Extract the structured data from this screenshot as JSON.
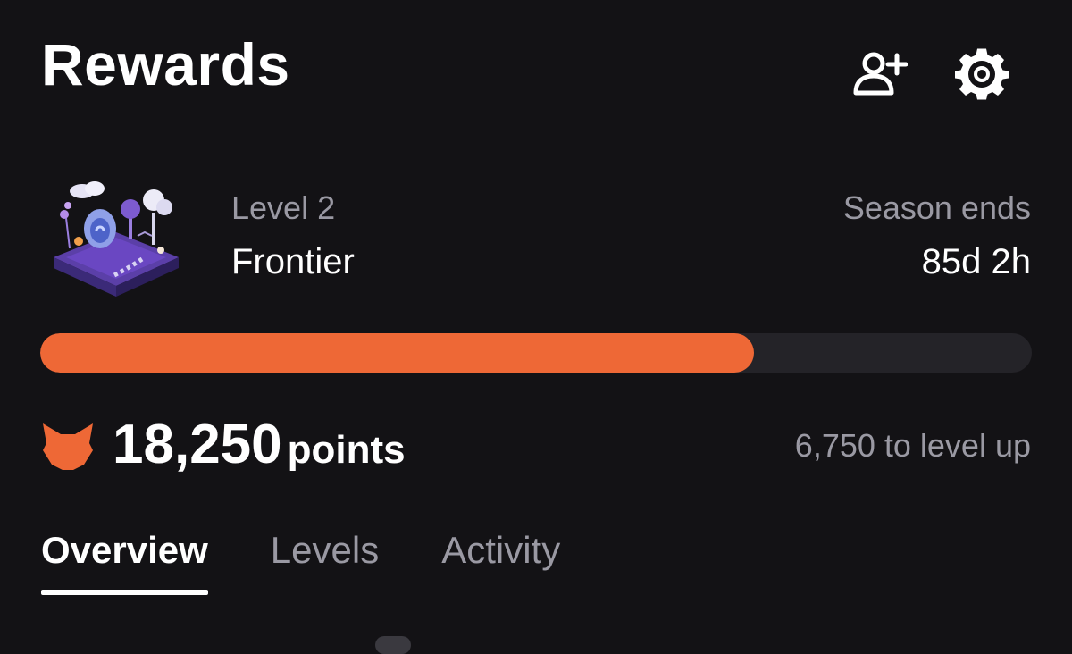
{
  "header": {
    "title": "Rewards",
    "icons": [
      "add-user-icon",
      "gear-icon"
    ]
  },
  "level": {
    "label": "Level 2",
    "name": "Frontier"
  },
  "season": {
    "label": "Season ends",
    "value": "85d 2h"
  },
  "progress": {
    "fraction": 0.72,
    "color": "#ee6836",
    "track_color": "#242328"
  },
  "points": {
    "value": "18,250",
    "unit": "points",
    "to_level": "6,750 to level up",
    "icon": "fox-icon",
    "icon_color": "#ee6836"
  },
  "tabs": [
    {
      "label": "Overview",
      "active": true
    },
    {
      "label": "Levels",
      "active": false
    },
    {
      "label": "Activity",
      "active": false
    }
  ],
  "colors": {
    "background": "#131215",
    "muted_text": "#9a99a3",
    "accent": "#ee6836"
  }
}
